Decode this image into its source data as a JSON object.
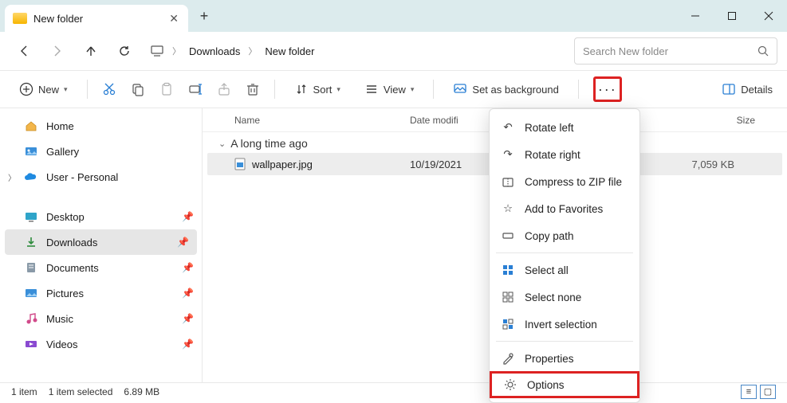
{
  "window": {
    "title": "New folder"
  },
  "breadcrumb": {
    "items": [
      "Downloads",
      "New folder"
    ]
  },
  "search": {
    "placeholder": "Search New folder"
  },
  "toolbar": {
    "new_label": "New",
    "sort_label": "Sort",
    "view_label": "View",
    "setbg_label": "Set as background",
    "details_label": "Details"
  },
  "sidebar": {
    "top": [
      {
        "label": "Home",
        "icon": "home"
      },
      {
        "label": "Gallery",
        "icon": "gallery"
      },
      {
        "label": "User - Personal",
        "icon": "onedrive",
        "expandable": true
      }
    ],
    "pinned": [
      {
        "label": "Desktop",
        "icon": "desktop"
      },
      {
        "label": "Downloads",
        "icon": "downloads",
        "active": true
      },
      {
        "label": "Documents",
        "icon": "documents"
      },
      {
        "label": "Pictures",
        "icon": "pictures"
      },
      {
        "label": "Music",
        "icon": "music"
      },
      {
        "label": "Videos",
        "icon": "videos"
      }
    ]
  },
  "columns": {
    "name": "Name",
    "date": "Date modifi",
    "type": "",
    "size": "Size"
  },
  "group_label": "A long time ago",
  "files": [
    {
      "name": "wallpaper.jpg",
      "date": "10/19/2021",
      "size": "7,059 KB"
    }
  ],
  "context_menu": {
    "items": [
      {
        "label": "Rotate left",
        "icon": "rotate-left"
      },
      {
        "label": "Rotate right",
        "icon": "rotate-right"
      },
      {
        "label": "Compress to ZIP file",
        "icon": "zip"
      },
      {
        "label": "Add to Favorites",
        "icon": "favorite"
      },
      {
        "label": "Copy path",
        "icon": "copypath"
      }
    ],
    "items2": [
      {
        "label": "Select all",
        "icon": "select-all"
      },
      {
        "label": "Select none",
        "icon": "select-none"
      },
      {
        "label": "Invert selection",
        "icon": "invert"
      }
    ],
    "items3": [
      {
        "label": "Properties",
        "icon": "properties"
      },
      {
        "label": "Options",
        "icon": "options",
        "highlight": true
      }
    ]
  },
  "status": {
    "count": "1 item",
    "selected": "1 item selected",
    "size": "6.89 MB"
  }
}
